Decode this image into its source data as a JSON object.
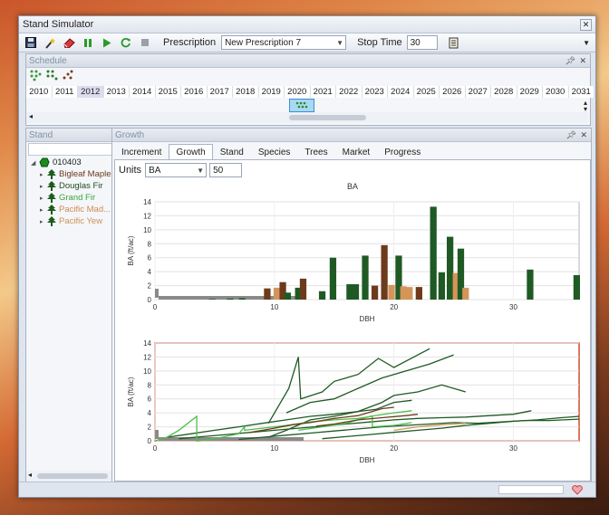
{
  "window": {
    "title": "Stand Simulator"
  },
  "toolbar": {
    "prescription_label": "Prescription",
    "prescription_value": "New Prescription 7",
    "stop_time_label": "Stop Time",
    "stop_time_value": "30"
  },
  "schedule": {
    "title": "Schedule",
    "years": [
      "2010",
      "2011",
      "2012",
      "2013",
      "2014",
      "2015",
      "2016",
      "2017",
      "2018",
      "2019",
      "2020",
      "2021",
      "2022",
      "2023",
      "2024",
      "2025",
      "2026",
      "2027",
      "2028",
      "2029",
      "2030",
      "2031"
    ],
    "selected_year": "2012",
    "event_year": "2020"
  },
  "stand": {
    "title": "Stand",
    "root": "010403",
    "species": [
      {
        "label": "Bigleaf Maple",
        "color": "#6b3a1a"
      },
      {
        "label": "Douglas Fir",
        "color": "#1f4d1f"
      },
      {
        "label": "Grand Fir",
        "color": "#3aa63a"
      },
      {
        "label": "Pacific Mad...",
        "color": "#cf8a4e"
      },
      {
        "label": "Pacific Yew",
        "color": "#d09057"
      }
    ]
  },
  "growth": {
    "title": "Growth",
    "tabs": [
      "Increment",
      "Growth",
      "Stand",
      "Species",
      "Trees",
      "Market",
      "Progress"
    ],
    "active_tab": "Growth",
    "units_label": "Units",
    "units_value": "BA",
    "units_count": "50"
  },
  "chart_data": [
    {
      "type": "bar",
      "title": "BA",
      "xlabel": "DBH",
      "ylabel": "BA (ft/ac)",
      "xlim": [
        0,
        35.5
      ],
      "ylim": [
        0,
        14
      ],
      "xticks": [
        0,
        10,
        20,
        30
      ],
      "yticks": [
        0,
        2,
        4,
        6,
        8,
        10,
        12,
        14
      ],
      "grid": true,
      "bars": [
        {
          "x": 4.8,
          "value": 0.1,
          "series": "Douglas Fir"
        },
        {
          "x": 6.3,
          "value": 0.15,
          "series": "Douglas Fir"
        },
        {
          "x": 7.3,
          "value": 0.2,
          "series": "Douglas Fir"
        },
        {
          "x": 9.4,
          "value": 1.6,
          "series": "Bigleaf Maple"
        },
        {
          "x": 10.2,
          "value": 1.7,
          "series": "Pacific Yew"
        },
        {
          "x": 10.7,
          "value": 2.5,
          "series": "Bigleaf Maple"
        },
        {
          "x": 11.1,
          "value": 1.0,
          "series": "Douglas Fir"
        },
        {
          "x": 12.0,
          "value": 1.7,
          "series": "Douglas Fir"
        },
        {
          "x": 12.4,
          "value": 3.0,
          "series": "Bigleaf Maple"
        },
        {
          "x": 14.0,
          "value": 1.2,
          "series": "Douglas Fir"
        },
        {
          "x": 14.9,
          "value": 6.0,
          "series": "Douglas Fir"
        },
        {
          "x": 16.3,
          "value": 2.2,
          "series": "Douglas Fir"
        },
        {
          "x": 16.8,
          "value": 2.2,
          "series": "Douglas Fir"
        },
        {
          "x": 17.6,
          "value": 6.3,
          "series": "Douglas Fir"
        },
        {
          "x": 18.4,
          "value": 2.0,
          "series": "Bigleaf Maple"
        },
        {
          "x": 19.2,
          "value": 7.8,
          "series": "Bigleaf Maple"
        },
        {
          "x": 19.8,
          "value": 2.1,
          "series": "Pacific Yew"
        },
        {
          "x": 20.4,
          "value": 6.3,
          "series": "Douglas Fir"
        },
        {
          "x": 20.8,
          "value": 1.9,
          "series": "Pacific Yew"
        },
        {
          "x": 21.3,
          "value": 1.8,
          "series": "Pacific Yew"
        },
        {
          "x": 22.1,
          "value": 1.8,
          "series": "Bigleaf Maple"
        },
        {
          "x": 23.3,
          "value": 13.3,
          "series": "Douglas Fir"
        },
        {
          "x": 24.0,
          "value": 3.9,
          "series": "Douglas Fir"
        },
        {
          "x": 24.7,
          "value": 9.0,
          "series": "Douglas Fir"
        },
        {
          "x": 25.2,
          "value": 3.8,
          "series": "Pacific Yew"
        },
        {
          "x": 25.6,
          "value": 7.3,
          "series": "Douglas Fir"
        },
        {
          "x": 26.0,
          "value": 1.7,
          "series": "Pacific Yew"
        },
        {
          "x": 31.4,
          "value": 4.3,
          "series": "Douglas Fir"
        },
        {
          "x": 35.3,
          "value": 3.5,
          "series": "Douglas Fir"
        }
      ]
    },
    {
      "type": "line",
      "xlabel": "DBH",
      "ylabel": "BA (ft/ac)",
      "xlim": [
        0,
        35.5
      ],
      "ylim": [
        0,
        14
      ],
      "xticks": [
        0,
        10,
        20,
        30
      ],
      "yticks": [
        0,
        2,
        4,
        6,
        8,
        10,
        12,
        14
      ],
      "grid": true,
      "series": [
        {
          "species": "Douglas Fir",
          "points": [
            [
              9.5,
              2.5
            ],
            [
              11.2,
              7.5
            ],
            [
              12,
              12
            ],
            [
              12.2,
              6
            ],
            [
              14,
              7
            ],
            [
              15,
              8.5
            ],
            [
              17,
              9.5
            ],
            [
              18.7,
              11.8
            ],
            [
              20,
              10.5
            ],
            [
              23,
              13.2
            ]
          ]
        },
        {
          "species": "Douglas Fir",
          "points": [
            [
              11,
              4
            ],
            [
              13,
              5.5
            ],
            [
              15,
              6
            ],
            [
              17,
              7.5
            ],
            [
              19,
              9
            ],
            [
              21,
              10
            ],
            [
              23,
              11
            ],
            [
              25,
              12.3
            ]
          ]
        },
        {
          "species": "Douglas Fir",
          "points": [
            [
              9.5,
              0.5
            ],
            [
              11,
              1.5
            ],
            [
              13,
              3
            ],
            [
              15,
              3.5
            ],
            [
              17,
              4.2
            ],
            [
              19,
              5.5
            ],
            [
              20,
              6.5
            ],
            [
              22,
              7
            ],
            [
              24,
              8
            ],
            [
              26,
              7
            ]
          ]
        },
        {
          "species": "Douglas Fir",
          "points": [
            [
              1,
              0.5
            ],
            [
              3,
              1
            ],
            [
              5,
              1.5
            ],
            [
              7,
              2
            ],
            [
              9,
              2.5
            ],
            [
              11,
              3
            ],
            [
              13,
              3.5
            ],
            [
              15,
              3.8
            ],
            [
              17,
              4.2
            ],
            [
              18.5,
              4.5
            ],
            [
              20,
              5.5
            ],
            [
              21.5,
              5.8
            ]
          ]
        },
        {
          "species": "Douglas Fir",
          "points": [
            [
              2,
              0.3
            ],
            [
              4,
              0.6
            ],
            [
              6,
              0.9
            ],
            [
              8,
              1.2
            ],
            [
              10,
              1.5
            ],
            [
              12,
              1.8
            ],
            [
              14,
              2.1
            ],
            [
              16,
              2.4
            ],
            [
              18,
              2.7
            ],
            [
              20,
              3
            ],
            [
              22,
              3.2
            ],
            [
              24,
              3.3
            ],
            [
              26,
              3.4
            ],
            [
              28,
              3.6
            ],
            [
              30,
              3.8
            ],
            [
              31.5,
              4.3
            ]
          ]
        },
        {
          "species": "Douglas Fir",
          "points": [
            [
              14,
              0.3
            ],
            [
              16,
              0.6
            ],
            [
              18,
              0.9
            ],
            [
              20,
              1.2
            ],
            [
              22,
              1.5
            ],
            [
              24,
              1.8
            ],
            [
              26,
              2.2
            ],
            [
              28,
              2.5
            ],
            [
              30,
              2.8
            ],
            [
              32,
              3
            ],
            [
              34,
              3.3
            ],
            [
              35.5,
              3.5
            ]
          ]
        },
        {
          "species": "Douglas Fir",
          "points": [
            [
              7,
              0.2
            ],
            [
              9,
              0.5
            ],
            [
              11,
              0.8
            ],
            [
              13,
              1.1
            ],
            [
              15,
              1.4
            ],
            [
              17,
              1.7
            ],
            [
              19,
              2
            ],
            [
              21,
              2.2
            ],
            [
              23,
              2.4
            ],
            [
              25,
              2.6
            ],
            [
              27,
              2.5
            ],
            [
              29,
              2.7
            ],
            [
              31,
              2.9
            ],
            [
              33,
              2.9
            ],
            [
              35.5,
              3.1
            ]
          ]
        },
        {
          "species": "Grand Fir",
          "points": [
            [
              0,
              0
            ],
            [
              1,
              0.5
            ],
            [
              2,
              1.5
            ],
            [
              3.5,
              3.5
            ],
            [
              3.5,
              0
            ],
            [
              5,
              0.3
            ],
            [
              7,
              1
            ],
            [
              7.5,
              2
            ],
            [
              7.5,
              1.5
            ],
            [
              9,
              1.8
            ],
            [
              11,
              2.2
            ],
            [
              13,
              2.7
            ],
            [
              15,
              3
            ],
            [
              17,
              3.2
            ],
            [
              18.2,
              3.5
            ],
            [
              18.2,
              2
            ],
            [
              20,
              2.2
            ],
            [
              21.5,
              2.6
            ]
          ]
        },
        {
          "species": "Grand Fir",
          "points": [
            [
              12,
              1.5
            ],
            [
              14,
              2
            ],
            [
              16,
              2.5
            ],
            [
              18,
              3.5
            ],
            [
              20,
              4
            ],
            [
              21.5,
              4.3
            ]
          ]
        },
        {
          "species": "Bigleaf Maple",
          "points": [
            [
              8,
              1.2
            ],
            [
              10,
              1.8
            ],
            [
              11.5,
              2.3
            ],
            [
              13,
              2.6
            ],
            [
              15,
              3.2
            ],
            [
              17,
              3.6
            ],
            [
              19,
              4.6
            ],
            [
              20,
              4.8
            ]
          ]
        },
        {
          "species": "Bigleaf Maple",
          "points": [
            [
              13.5,
              2.1
            ],
            [
              15,
              2.4
            ],
            [
              17,
              3
            ],
            [
              19,
              3.3
            ],
            [
              21,
              3.6
            ],
            [
              22,
              3.8
            ]
          ]
        },
        {
          "species": "Pacific Yew",
          "points": [
            [
              20,
              1.5
            ],
            [
              22,
              2
            ],
            [
              24,
              2.3
            ],
            [
              26,
              2.5
            ]
          ]
        }
      ]
    }
  ]
}
